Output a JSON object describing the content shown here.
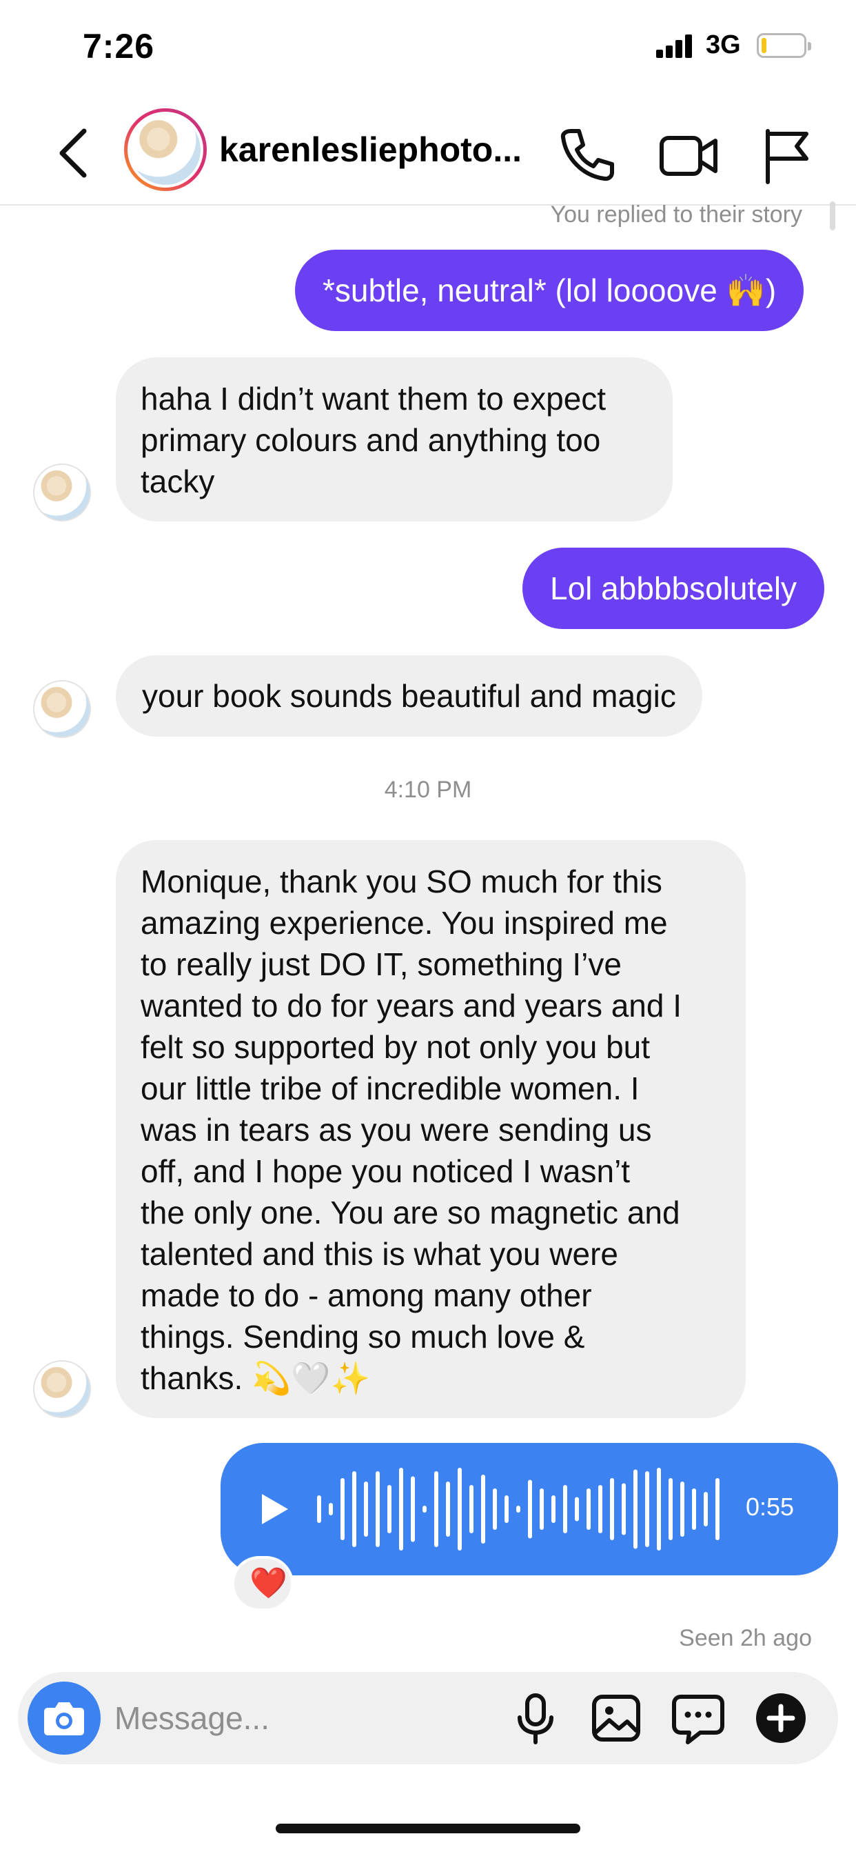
{
  "status_bar": {
    "time": "7:26",
    "network": "3G",
    "battery_fraction": 0.12
  },
  "header": {
    "username": "karenlesliephoto...",
    "icons": [
      "back-chevron-icon",
      "phone-icon",
      "video-camera-icon",
      "flag-icon"
    ]
  },
  "conversation": {
    "story_note": "You replied to their story",
    "messages": [
      {
        "sender": "me",
        "text": "*subtle, neutral* (lol loooove 🙌)"
      },
      {
        "sender": "them",
        "lines": [
          "haha I didn’t want them to expect",
          "primary colours and anything too",
          "tacky"
        ]
      },
      {
        "sender": "me",
        "text": "Lol abbbbsolutely"
      },
      {
        "sender": "them",
        "text": "your book sounds beautiful and magic"
      }
    ],
    "timestamp": "4:10 PM",
    "long_message": {
      "sender": "them",
      "lines": [
        "Monique, thank you SO much for this",
        "amazing experience. You inspired me",
        "to really just DO IT, something I’ve",
        "wanted to do for years and years and I",
        "felt so supported by not only you but",
        "our little tribe of incredible women. I",
        "was in tears as you were sending us",
        "off, and I hope you noticed I wasn’t",
        "the only one. You are so magnetic and",
        "talented and this is what you were",
        "made to do - among many other",
        "things. Sending so much love &",
        "thanks. 💫🤍✨"
      ]
    },
    "voice_message": {
      "sender": "me",
      "duration": "0:55",
      "reaction": "❤️"
    },
    "seen_status": "Seen 2h ago"
  },
  "composer": {
    "placeholder": "Message...",
    "icons": [
      "camera-icon",
      "microphone-icon",
      "gallery-icon",
      "sticker-chat-icon",
      "add-plus-icon"
    ]
  },
  "colors": {
    "outgoing_bubble": "#6b3ff2",
    "incoming_bubble": "#efefef",
    "voice_bubble": "#3c82f0",
    "camera_button": "#3c82f0"
  }
}
